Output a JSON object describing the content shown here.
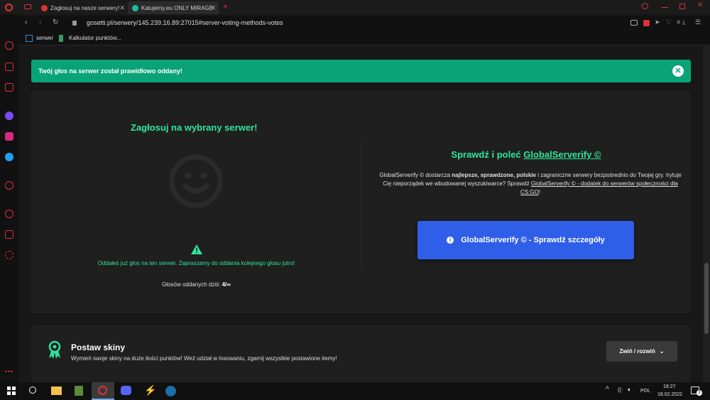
{
  "browser": {
    "tabs": [
      {
        "label": "Zagłosuj na nasze serwery!"
      },
      {
        "label": "Katujemy.eu ONLY MIRAGE"
      }
    ],
    "new_tab_label": "+",
    "url": "gosetti.pl/serwery/145.239.16.89:27015#server-voting-methods-votes",
    "bookmarks": [
      {
        "label": "serwer"
      },
      {
        "label": "Kalkulator punktów..."
      }
    ]
  },
  "toast": {
    "message": "Twój głos na serwer został prawidłowo oddany!",
    "close_label": "✕"
  },
  "vote": {
    "title": "Zagłosuj na wybrany serwer!",
    "already_voted": "Oddałeś już głos na ten serwer. Zapraszamy do oddania kolejnego głosu jutro!",
    "count_label": "Głosów oddanych dziś:",
    "count_value": "4/∞"
  },
  "globalserverify": {
    "title_prefix": "Sprawdź i poleć",
    "title_link": "GlobalServerify ©",
    "desc_1": "GlobalServerify © dostarcza",
    "desc_bold": "najlepsze, sprawdzone, polskie",
    "desc_2": "i zagraniczne serwery bezpośrednio do Twojej gry. Irytuje Cię nieporządek we wbudowanej wyszukiwarce? Sprawdź",
    "desc_link": "GlobalServerify © - dodatek do serwerów społeczności dla CS:GO",
    "desc_end": "!",
    "button_label": "GlobalServerify © - Sprawdź szczegóły"
  },
  "skins": {
    "title": "Postaw skiny",
    "description": "Wymień swoje skiny na duże ilości punktów! Weź udział w losowaniu, zgarnij wszystkie postawione itemy!",
    "toggle_label": "Zwiń / rozwiń"
  },
  "taskbar": {
    "language": "POL",
    "time": "18:27",
    "date": "18.02.2022",
    "notifications": "3"
  },
  "colors": {
    "accent": "#2ee59d",
    "toast": "#0aa378",
    "button": "#2f5fe8"
  }
}
